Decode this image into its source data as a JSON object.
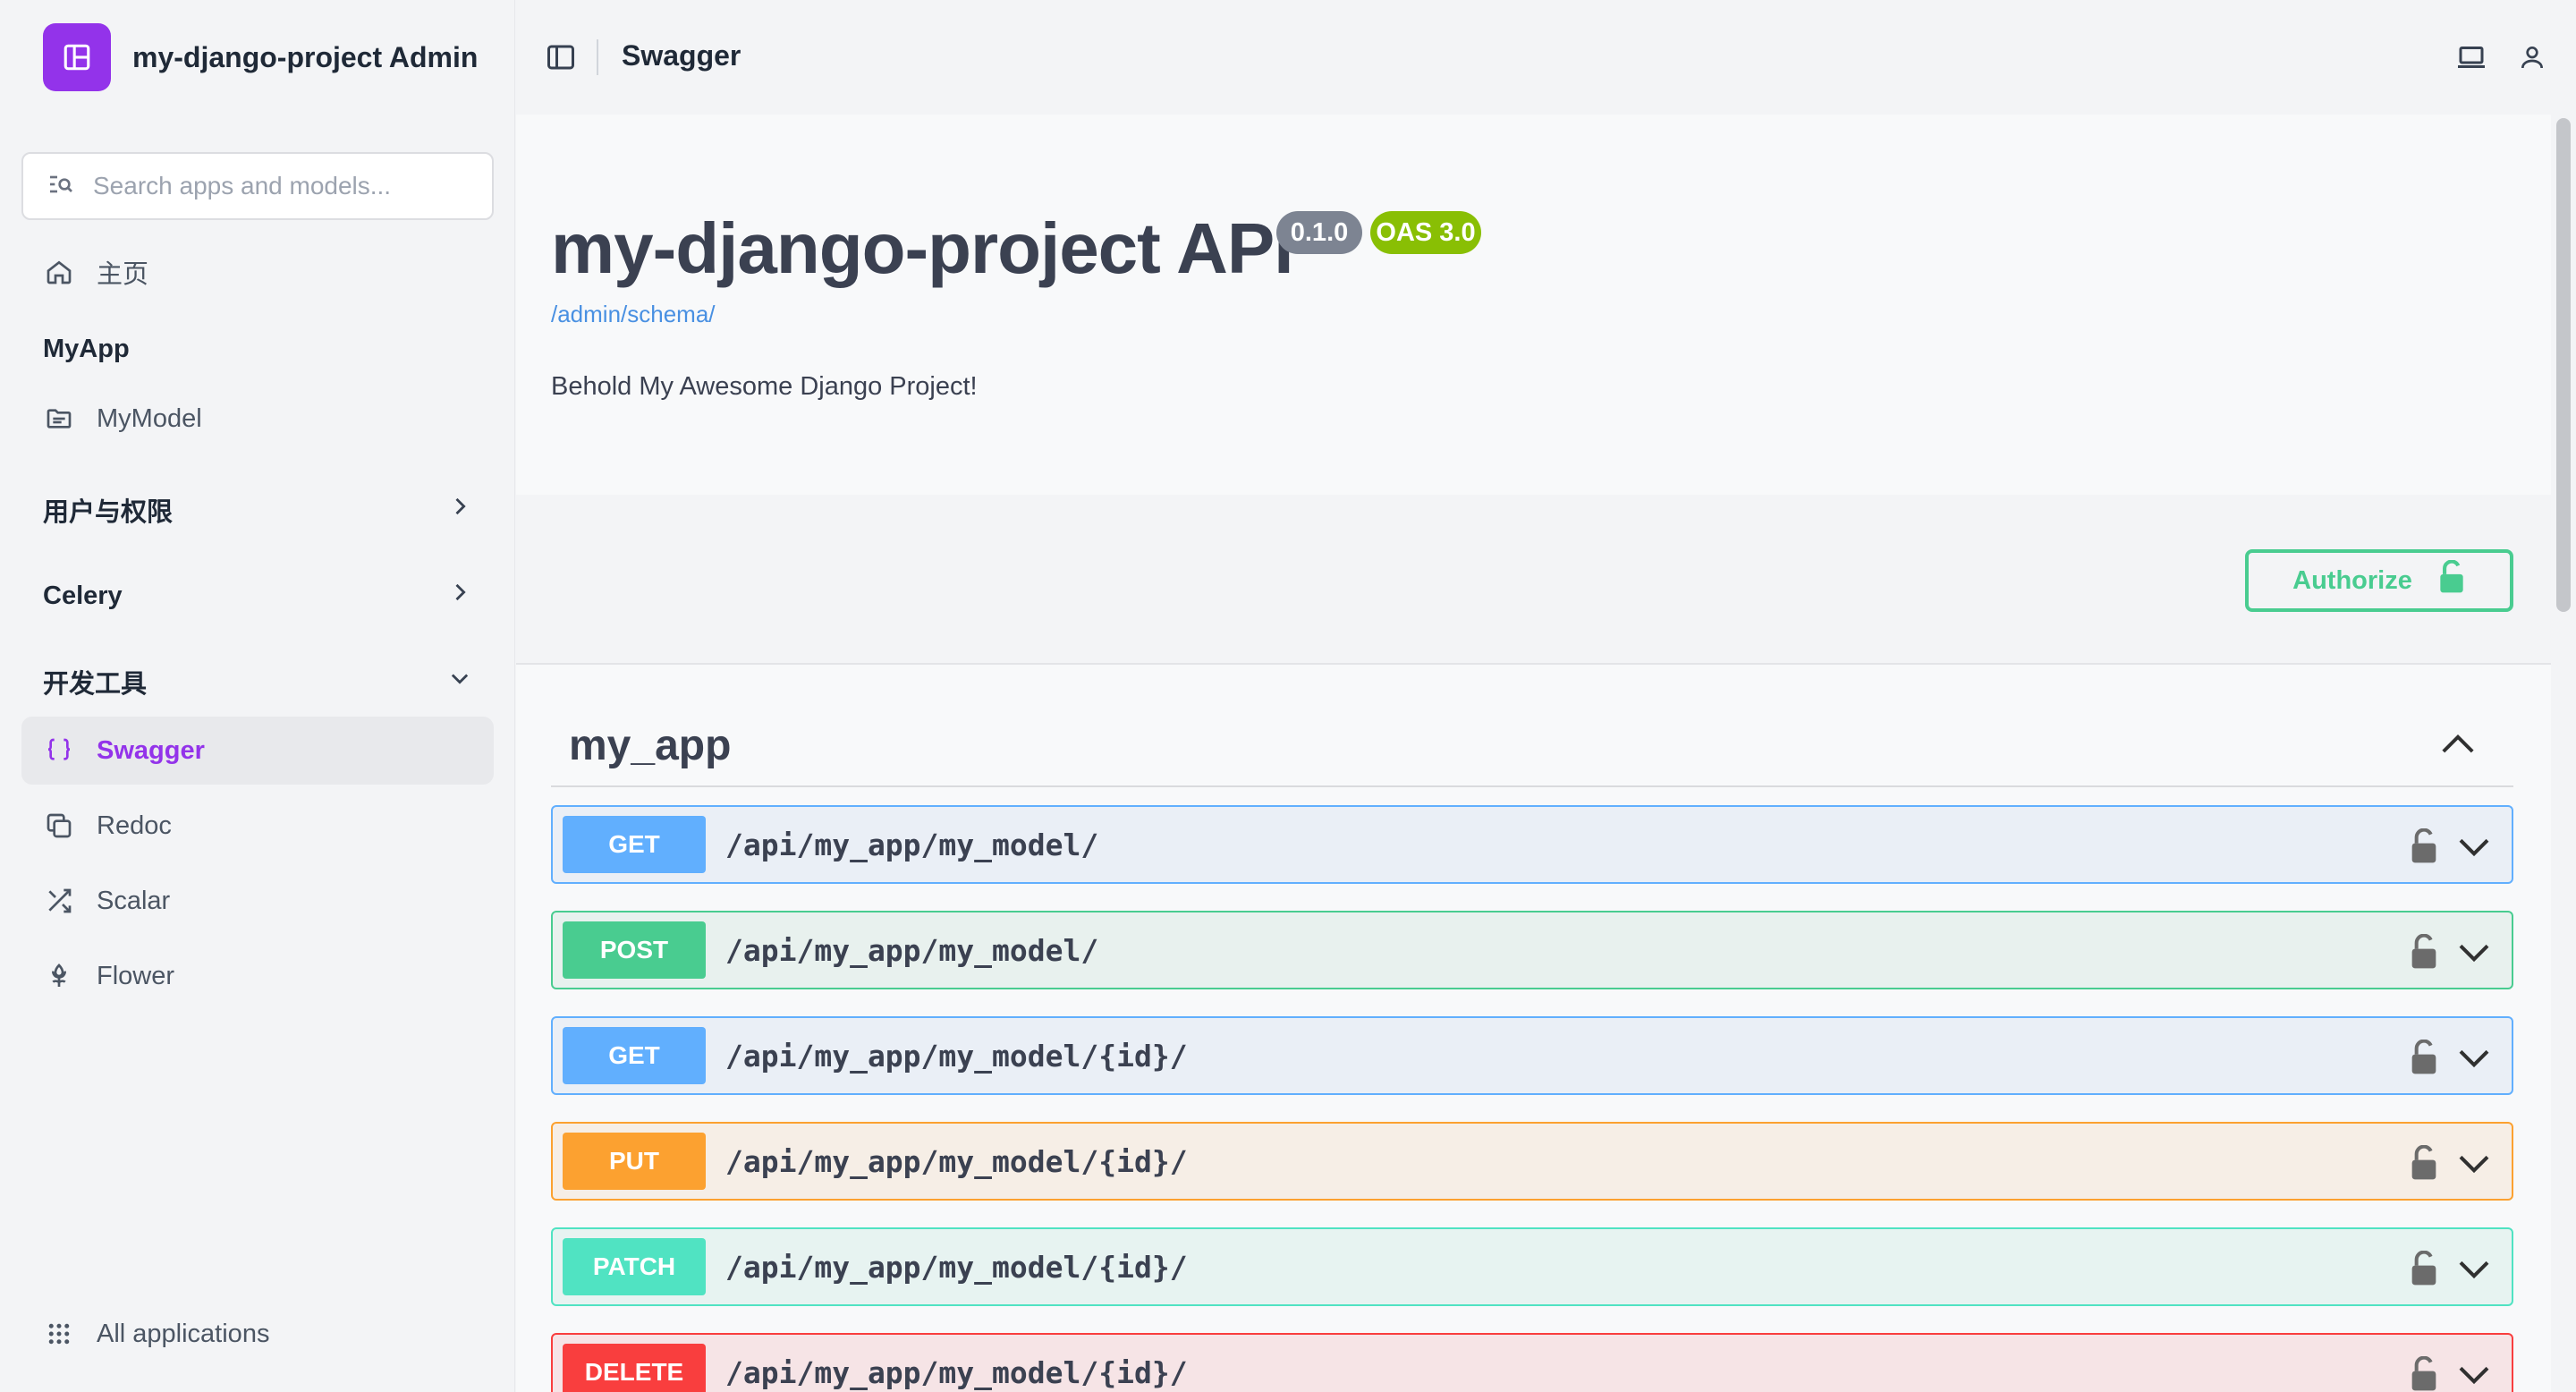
{
  "sidebar": {
    "brand_title": "my-django-project Admin",
    "search_placeholder": "Search apps and models...",
    "home_label": "主页",
    "app_heading": "MyApp",
    "model_label": "MyModel",
    "groups": [
      {
        "label": "用户与权限",
        "state": "collapsed"
      },
      {
        "label": "Celery",
        "state": "collapsed"
      },
      {
        "label": "开发工具",
        "state": "expanded"
      }
    ],
    "tools": [
      {
        "label": "Swagger",
        "icon": "braces-icon",
        "active": true
      },
      {
        "label": "Redoc",
        "icon": "copy-icon",
        "active": false
      },
      {
        "label": "Scalar",
        "icon": "shuffle-icon",
        "active": false
      },
      {
        "label": "Flower",
        "icon": "flower-icon",
        "active": false
      }
    ],
    "all_apps_label": "All applications",
    "accent_color": "#9333ea"
  },
  "header": {
    "title": "Swagger"
  },
  "swagger": {
    "api_title": "my-django-project API",
    "version": "0.1.0",
    "oas": "OAS 3.0",
    "schema_link": "/admin/schema/",
    "description": "Behold My Awesome Django Project!",
    "authorize_label": "Authorize",
    "tag_name": "my_app",
    "operations": [
      {
        "method": "GET",
        "path": "/api/my_app/my_model/",
        "color": "#61affe"
      },
      {
        "method": "POST",
        "path": "/api/my_app/my_model/",
        "color": "#49cc90"
      },
      {
        "method": "GET",
        "path": "/api/my_app/my_model/{id}/",
        "color": "#61affe"
      },
      {
        "method": "PUT",
        "path": "/api/my_app/my_model/{id}/",
        "color": "#fca130"
      },
      {
        "method": "PATCH",
        "path": "/api/my_app/my_model/{id}/",
        "color": "#50e3c2"
      },
      {
        "method": "DELETE",
        "path": "/api/my_app/my_model/{id}/",
        "color": "#f93e3e"
      }
    ]
  }
}
